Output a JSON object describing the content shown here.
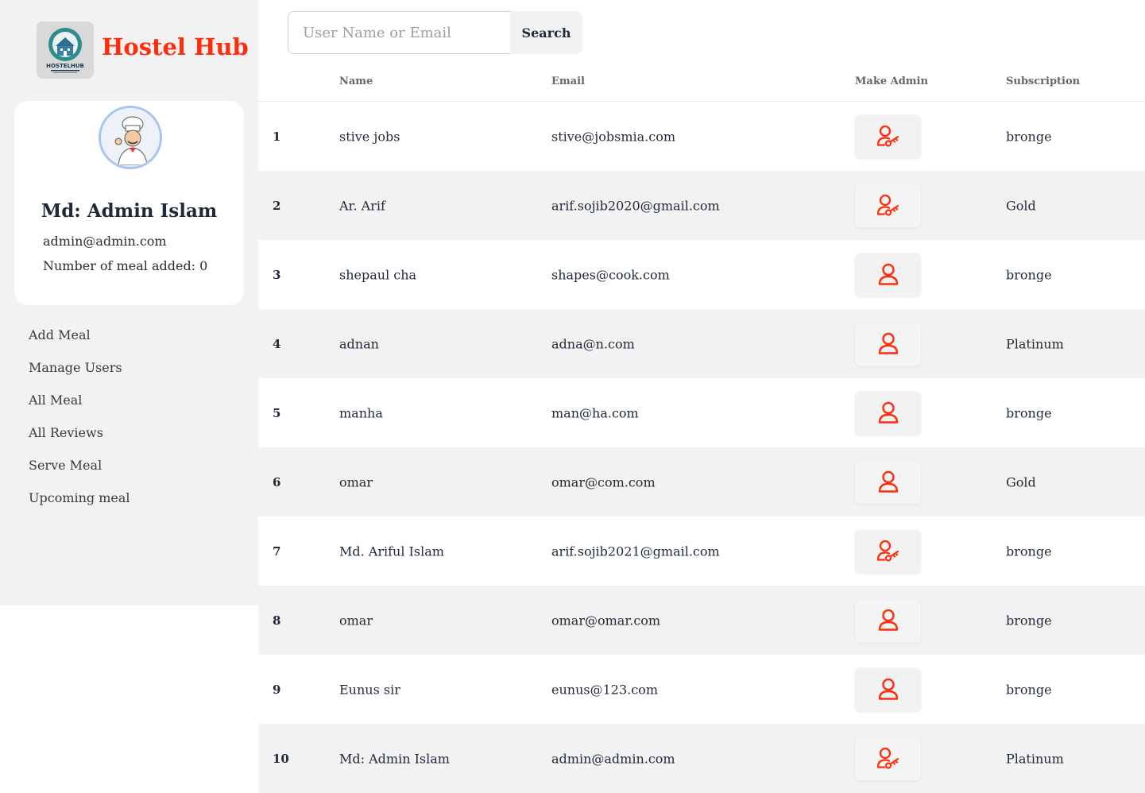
{
  "sidebar": {
    "brand": "Hostel Hub",
    "logo_text": "HOSTELHUB",
    "profile": {
      "name": "Md: Admin Islam",
      "email": "admin@admin.com",
      "meals_added": "Number of meal added: 0"
    },
    "nav": [
      {
        "label": "Add Meal"
      },
      {
        "label": "Manage Users"
      },
      {
        "label": "All Meal"
      },
      {
        "label": "All Reviews"
      },
      {
        "label": "Serve Meal"
      },
      {
        "label": "Upcoming meal"
      }
    ]
  },
  "search": {
    "placeholder": "User Name or Email",
    "value": "",
    "button_label": "Search"
  },
  "table": {
    "columns": {
      "index": "",
      "name": "Name",
      "email": "Email",
      "make_admin": "Make Admin",
      "subscription": "Subscription"
    },
    "rows": [
      {
        "index": "1",
        "name": "stive jobs",
        "email": "stive@jobsmia.com",
        "admin_icon": "user-key-icon",
        "subscription": "bronge"
      },
      {
        "index": "2",
        "name": "Ar. Arif",
        "email": "arif.sojib2020@gmail.com",
        "admin_icon": "user-key-icon",
        "subscription": "Gold"
      },
      {
        "index": "3",
        "name": "shepaul cha",
        "email": "shapes@cook.com",
        "admin_icon": "user-icon",
        "subscription": "bronge"
      },
      {
        "index": "4",
        "name": "adnan",
        "email": "adna@n.com",
        "admin_icon": "user-icon",
        "subscription": "Platinum"
      },
      {
        "index": "5",
        "name": "manha",
        "email": "man@ha.com",
        "admin_icon": "user-icon",
        "subscription": "bronge"
      },
      {
        "index": "6",
        "name": "omar",
        "email": "omar@com.com",
        "admin_icon": "user-icon",
        "subscription": "Gold"
      },
      {
        "index": "7",
        "name": "Md. Ariful Islam",
        "email": "arif.sojib2021@gmail.com",
        "admin_icon": "user-key-icon",
        "subscription": "bronge"
      },
      {
        "index": "8",
        "name": "omar",
        "email": "omar@omar.com",
        "admin_icon": "user-icon",
        "subscription": "bronge"
      },
      {
        "index": "9",
        "name": "Eunus sir",
        "email": "eunus@123.com",
        "admin_icon": "user-icon",
        "subscription": "bronge"
      },
      {
        "index": "10",
        "name": "Md: Admin Islam",
        "email": "admin@admin.com",
        "admin_icon": "user-key-icon",
        "subscription": "Platinum"
      }
    ]
  },
  "colors": {
    "accent": "#ff2d0d",
    "sidebar_bg": "#f2f2f2",
    "row_alt_bg": "#f2f2f2"
  }
}
